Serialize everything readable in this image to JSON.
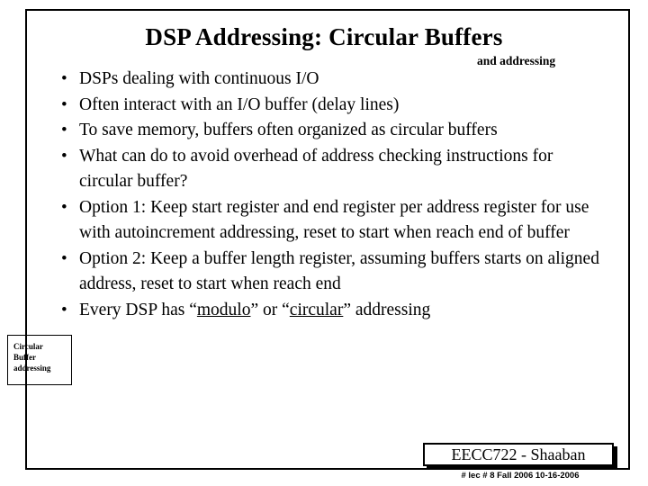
{
  "slide": {
    "title": "DSP Addressing: Circular Buffers",
    "subnote": "and  addressing",
    "side_label": "Circular\nBuffer\naddressing",
    "side_label_lines": [
      "Circular",
      "Buffer",
      "addressing"
    ],
    "bullets": [
      {
        "marker": "•",
        "text": "DSPs dealing with continuous I/O"
      },
      {
        "marker": "•",
        "text": "Often interact with an I/O buffer (delay lines)"
      },
      {
        "marker": "•",
        "text": "To save memory, buffers often organized as circular buffers"
      },
      {
        "marker": "•",
        "text": "What can do to avoid overhead of address checking instructions for circular buffer?"
      },
      {
        "marker": "•",
        "text": "Option 1: Keep start register and end register per address register for use with autoincrement addressing, reset to start when reach end of buffer"
      },
      {
        "marker": "•",
        "text": "Option 2: Keep a buffer length register, assuming buffers starts on aligned address, reset to start when reach end"
      },
      {
        "marker": "•",
        "text": "Every DSP has “modulo” or “circular” addressing",
        "underlined": [
          "modulo",
          "circular"
        ]
      }
    ],
    "footer": {
      "course": "EECC722 - Shaaban",
      "meta": "#  lec # 8    Fall 2006   10-16-2006"
    }
  }
}
